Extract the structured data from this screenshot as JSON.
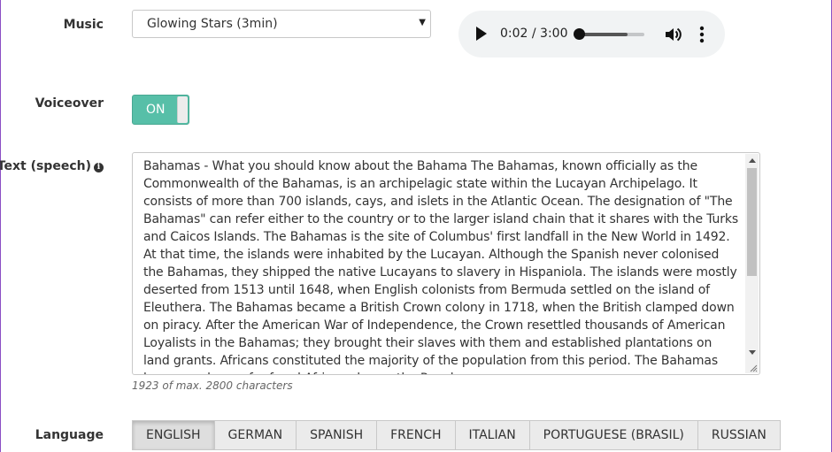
{
  "music": {
    "label": "Music",
    "selected": "Glowing Stars (3min)",
    "caret_icon": "caret-down-icon"
  },
  "player": {
    "time": "0:02 / 3:00",
    "progress": 0.011,
    "buffered": 0.75,
    "play_icon": "play-icon",
    "volume_icon": "volume-icon",
    "more_icon": "more-vertical-icon"
  },
  "voiceover": {
    "label": "Voiceover",
    "state": "ON",
    "color": "#57bfa8"
  },
  "text_speech": {
    "label": "Text (speech)",
    "info_icon": "info-icon",
    "value": "Bahamas - What you should know about the Bahama The Bahamas, known officially as the Commonwealth of the Bahamas, is an archipelagic state within the Lucayan Archipelago. It consists of more than 700 islands, cays, and islets in the Atlantic Ocean. The designation of \"The Bahamas\" can refer either to the country or to the larger island chain that it shares with the Turks and Caicos Islands. The Bahamas is the site of Columbus' first landfall in the New World in 1492. At that time, the islands were inhabited by the Lucayan. Although the Spanish never colonised the Bahamas, they shipped the native Lucayans to slavery in Hispaniola. The islands were mostly deserted from 1513 until 1648, when English colonists from Bermuda settled on the island of Eleuthera. The Bahamas became a British Crown colony in 1718, when the British clamped down on piracy. After the American War of Independence, the Crown resettled thousands of American Loyalists in the Bahamas; they brought their slaves with them and established plantations on land grants. Africans constituted the majority of the population from this period. The Bahamas became a haven for freed African slaves: the Royal",
    "counter": "1923 of max. 2800 characters"
  },
  "language": {
    "label": "Language",
    "options": [
      "ENGLISH",
      "GERMAN",
      "SPANISH",
      "FRENCH",
      "ITALIAN",
      "PORTUGUESE (BRASIL)",
      "RUSSIAN"
    ],
    "selected": "ENGLISH"
  }
}
